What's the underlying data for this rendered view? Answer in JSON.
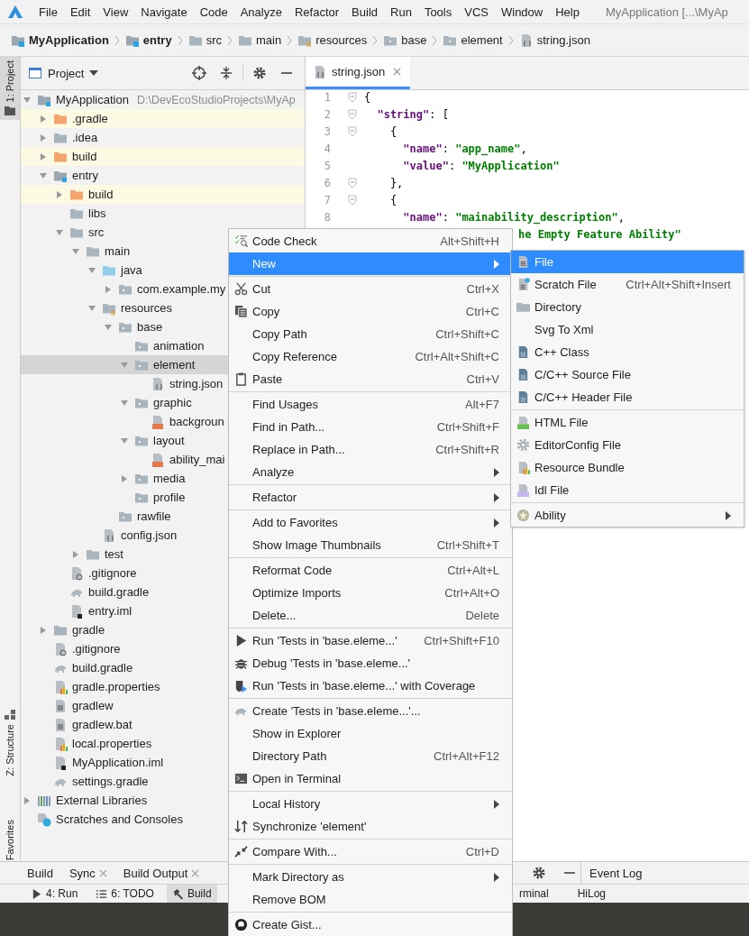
{
  "menubar": {
    "items": [
      "File",
      "Edit",
      "View",
      "Navigate",
      "Code",
      "Analyze",
      "Refactor",
      "Build",
      "Run",
      "Tools",
      "VCS",
      "Window",
      "Help"
    ],
    "title": "MyApplication [...\\MyAp"
  },
  "breadcrumb": [
    {
      "label": "MyApplication",
      "kind": "module"
    },
    {
      "label": "entry",
      "kind": "module"
    },
    {
      "label": "src",
      "kind": "folder"
    },
    {
      "label": "main",
      "kind": "folder"
    },
    {
      "label": "resources",
      "kind": "resources"
    },
    {
      "label": "base",
      "kind": "package"
    },
    {
      "label": "element",
      "kind": "package"
    },
    {
      "label": "string.json",
      "kind": "json"
    }
  ],
  "tool_strip": [
    {
      "label": "1: Project",
      "kind": "project",
      "selected": true
    },
    {
      "label": "Z: Structure",
      "kind": "structure",
      "selected": false
    },
    {
      "label": "Favorites",
      "kind": "favorites",
      "selected": false
    }
  ],
  "project": {
    "title": "Project",
    "tree": [
      {
        "label": "MyApplication",
        "path": "D:\\DevEcoStudioProjects\\MyAp",
        "kind": "module",
        "expanded": true,
        "selected": false,
        "children": [
          {
            "label": ".gradle",
            "kind": "excluded",
            "expanded": false,
            "selected": false
          },
          {
            "label": ".idea",
            "kind": "folder",
            "expanded": false,
            "selected": false
          },
          {
            "label": "build",
            "kind": "excluded",
            "expanded": false,
            "selected": false
          },
          {
            "label": "entry",
            "kind": "module",
            "expanded": true,
            "selected": false,
            "children": [
              {
                "label": "build",
                "kind": "excluded",
                "expanded": false,
                "selected": false
              },
              {
                "label": "libs",
                "kind": "folder",
                "selected": false
              },
              {
                "label": "src",
                "kind": "folder",
                "expanded": true,
                "selected": false,
                "children": [
                  {
                    "label": "main",
                    "kind": "folder",
                    "expanded": true,
                    "selected": false,
                    "children": [
                      {
                        "label": "java",
                        "kind": "source",
                        "expanded": true,
                        "selected": false,
                        "children": [
                          {
                            "label": "com.example.my",
                            "kind": "package",
                            "expanded": false,
                            "selected": false
                          }
                        ]
                      },
                      {
                        "label": "resources",
                        "kind": "resources",
                        "expanded": true,
                        "selected": false,
                        "children": [
                          {
                            "label": "base",
                            "kind": "package",
                            "expanded": true,
                            "selected": false,
                            "children": [
                              {
                                "label": "animation",
                                "kind": "package",
                                "selected": false
                              },
                              {
                                "label": "element",
                                "kind": "package",
                                "expanded": true,
                                "selected": true,
                                "children": [
                                  {
                                    "label": "string.json",
                                    "kind": "json",
                                    "selected": false
                                  }
                                ]
                              },
                              {
                                "label": "graphic",
                                "kind": "package",
                                "expanded": true,
                                "selected": false,
                                "children": [
                                  {
                                    "label": "backgroun",
                                    "kind": "xml",
                                    "selected": false
                                  }
                                ]
                              },
                              {
                                "label": "layout",
                                "kind": "package",
                                "expanded": true,
                                "selected": false,
                                "children": [
                                  {
                                    "label": "ability_mai",
                                    "kind": "xml",
                                    "selected": false
                                  }
                                ]
                              },
                              {
                                "label": "media",
                                "kind": "package",
                                "expanded": false,
                                "selected": false
                              },
                              {
                                "label": "profile",
                                "kind": "package",
                                "selected": false
                              }
                            ]
                          },
                          {
                            "label": "rawfile",
                            "kind": "package",
                            "selected": false
                          }
                        ]
                      },
                      {
                        "label": "config.json",
                        "kind": "json",
                        "selected": false
                      }
                    ]
                  },
                  {
                    "label": "test",
                    "kind": "folder",
                    "expanded": false,
                    "selected": false
                  }
                ]
              },
              {
                "label": ".gitignore",
                "kind": "ignore",
                "selected": false
              },
              {
                "label": "build.gradle",
                "kind": "gradle",
                "selected": false
              },
              {
                "label": "entry.iml",
                "kind": "iml",
                "selected": false
              }
            ]
          },
          {
            "label": "gradle",
            "kind": "folder",
            "expanded": false,
            "selected": false
          },
          {
            "label": ".gitignore",
            "kind": "ignore",
            "selected": false
          },
          {
            "label": "build.gradle",
            "kind": "gradle",
            "selected": false
          },
          {
            "label": "gradle.properties",
            "kind": "properties",
            "selected": false
          },
          {
            "label": "gradlew",
            "kind": "text",
            "selected": false
          },
          {
            "label": "gradlew.bat",
            "kind": "text",
            "selected": false
          },
          {
            "label": "local.properties",
            "kind": "properties",
            "selected": false
          },
          {
            "label": "MyApplication.iml",
            "kind": "iml",
            "selected": false
          },
          {
            "label": "settings.gradle",
            "kind": "gradle",
            "selected": false
          }
        ]
      },
      {
        "label": "External Libraries",
        "kind": "libraries",
        "expanded": false,
        "selected": false
      },
      {
        "label": "Scratches and Consoles",
        "kind": "scratches",
        "selected": false
      }
    ]
  },
  "editor": {
    "tabs": [
      {
        "label": "string.json",
        "selected": true
      }
    ],
    "lines": [
      {
        "number": "1",
        "fold": true,
        "tokens": [
          {
            "text": "{",
            "kind": "punct"
          }
        ]
      },
      {
        "number": "2",
        "fold": true,
        "tokens": [
          {
            "text": "\"string\"",
            "kind": "key"
          },
          {
            "text": ": [",
            "kind": "punct"
          }
        ]
      },
      {
        "number": "3",
        "fold": true,
        "tokens": [
          {
            "text": "{",
            "kind": "punct"
          }
        ]
      },
      {
        "number": "4",
        "fold": false,
        "tokens": [
          {
            "text": "\"name\"",
            "kind": "key"
          },
          {
            "text": ": ",
            "kind": "punct"
          },
          {
            "text": "\"app_name\"",
            "kind": "value"
          },
          {
            "text": ",",
            "kind": "punct"
          }
        ]
      },
      {
        "number": "5",
        "fold": false,
        "tokens": [
          {
            "text": "\"value\"",
            "kind": "key"
          },
          {
            "text": ": ",
            "kind": "punct"
          },
          {
            "text": "\"MyApplication\"",
            "kind": "value"
          }
        ]
      },
      {
        "number": "6",
        "fold": true,
        "tokens": [
          {
            "text": "},",
            "kind": "punct"
          }
        ]
      },
      {
        "number": "7",
        "fold": true,
        "tokens": [
          {
            "text": "{",
            "kind": "punct"
          }
        ]
      },
      {
        "number": "8",
        "fold": false,
        "tokens": [
          {
            "text": "\"name\"",
            "kind": "key"
          },
          {
            "text": ": ",
            "kind": "punct"
          },
          {
            "text": "\"mainability_description\"",
            "kind": "value"
          },
          {
            "text": ",",
            "kind": "punct"
          }
        ]
      }
    ],
    "cut_line": "he Empty Feature Ability\""
  },
  "context_menu": {
    "sections": [
      [
        {
          "label": "Code Check",
          "shortcut": "Alt+Shift+H",
          "kind": "code-check",
          "submenu": false,
          "selected": false
        },
        {
          "label": "New",
          "submenu": true,
          "selected": true
        }
      ],
      [
        {
          "label": "Cut",
          "shortcut": "Ctrl+X",
          "kind": "cut",
          "submenu": false,
          "selected": false
        },
        {
          "label": "Copy",
          "shortcut": "Ctrl+C",
          "kind": "copy",
          "submenu": false,
          "selected": false
        },
        {
          "label": "Copy Path",
          "shortcut": "Ctrl+Shift+C",
          "submenu": false,
          "selected": false
        },
        {
          "label": "Copy Reference",
          "shortcut": "Ctrl+Alt+Shift+C",
          "submenu": false,
          "selected": false
        },
        {
          "label": "Paste",
          "shortcut": "Ctrl+V",
          "kind": "paste",
          "submenu": false,
          "selected": false
        }
      ],
      [
        {
          "label": "Find Usages",
          "shortcut": "Alt+F7",
          "submenu": false,
          "selected": false
        },
        {
          "label": "Find in Path...",
          "shortcut": "Ctrl+Shift+F",
          "submenu": false,
          "selected": false
        },
        {
          "label": "Replace in Path...",
          "shortcut": "Ctrl+Shift+R",
          "submenu": false,
          "selected": false
        },
        {
          "label": "Analyze",
          "submenu": true,
          "selected": false
        }
      ],
      [
        {
          "label": "Refactor",
          "submenu": true,
          "selected": false
        }
      ],
      [
        {
          "label": "Add to Favorites",
          "submenu": true,
          "selected": false
        },
        {
          "label": "Show Image Thumbnails",
          "shortcut": "Ctrl+Shift+T",
          "submenu": false,
          "selected": false
        }
      ],
      [
        {
          "label": "Reformat Code",
          "shortcut": "Ctrl+Alt+L",
          "submenu": false,
          "selected": false
        },
        {
          "label": "Optimize Imports",
          "shortcut": "Ctrl+Alt+O",
          "submenu": false,
          "selected": false
        },
        {
          "label": "Delete...",
          "shortcut": "Delete",
          "submenu": false,
          "selected": false
        }
      ],
      [
        {
          "label": "Run 'Tests in 'base.eleme...'",
          "shortcut": "Ctrl+Shift+F10",
          "kind": "run",
          "submenu": false,
          "selected": false
        },
        {
          "label": "Debug 'Tests in 'base.eleme...'",
          "kind": "debug",
          "submenu": false,
          "selected": false
        },
        {
          "label": "Run 'Tests in 'base.eleme...' with Coverage",
          "kind": "coverage",
          "submenu": false,
          "selected": false
        }
      ],
      [
        {
          "label": "Create 'Tests in 'base.eleme...'...",
          "kind": "gradle",
          "submenu": false,
          "selected": false
        },
        {
          "label": "Show in Explorer",
          "submenu": false,
          "selected": false
        },
        {
          "label": "Directory Path",
          "shortcut": "Ctrl+Alt+F12",
          "submenu": false,
          "selected": false
        },
        {
          "label": "Open in Terminal",
          "kind": "terminal",
          "submenu": false,
          "selected": false
        }
      ],
      [
        {
          "label": "Local History",
          "submenu": true,
          "selected": false
        },
        {
          "label": "Synchronize 'element'",
          "kind": "sync",
          "submenu": false,
          "selected": false
        }
      ],
      [
        {
          "label": "Compare With...",
          "shortcut": "Ctrl+D",
          "kind": "compare",
          "submenu": false,
          "selected": false
        }
      ],
      [
        {
          "label": "Mark Directory as",
          "submenu": true,
          "selected": false
        },
        {
          "label": "Remove BOM",
          "submenu": false,
          "selected": false
        }
      ],
      [
        {
          "label": "Create Gist...",
          "kind": "github",
          "submenu": false,
          "selected": false
        }
      ]
    ]
  },
  "new_submenu": {
    "sections": [
      [
        {
          "label": "File",
          "kind": "file",
          "submenu": false,
          "selected": true
        },
        {
          "label": "Scratch File",
          "shortcut": "Ctrl+Alt+Shift+Insert",
          "kind": "scratch",
          "submenu": false,
          "selected": false
        },
        {
          "label": "Directory",
          "kind": "directory",
          "submenu": false,
          "selected": false
        },
        {
          "label": "Svg To Xml",
          "submenu": false,
          "selected": false
        },
        {
          "label": "C++ Class",
          "kind": "cpp",
          "submenu": false,
          "selected": false
        },
        {
          "label": "C/C++ Source File",
          "kind": "csource",
          "submenu": false,
          "selected": false
        },
        {
          "label": "C/C++ Header File",
          "kind": "cheader",
          "submenu": false,
          "selected": false
        }
      ],
      [
        {
          "label": "HTML File",
          "kind": "html",
          "submenu": false,
          "selected": false
        },
        {
          "label": "EditorConfig File",
          "kind": "editorconfig",
          "submenu": false,
          "selected": false
        },
        {
          "label": "Resource Bundle",
          "kind": "bundle",
          "submenu": false,
          "selected": false
        },
        {
          "label": "Idl File",
          "kind": "idl",
          "submenu": false,
          "selected": false
        }
      ],
      [
        {
          "label": "Ability",
          "kind": "ability",
          "submenu": true,
          "selected": false
        }
      ]
    ]
  },
  "build_window": {
    "title": "Build",
    "tabs": [
      {
        "label": "Sync"
      },
      {
        "label": "Build Output"
      }
    ]
  },
  "event_log": {
    "title": "Event Log"
  },
  "status_bar": {
    "left": [
      {
        "label": "4: Run",
        "kind": "run",
        "selected": false
      },
      {
        "label": "6: TODO",
        "kind": "todo",
        "selected": false
      },
      {
        "label": "Build",
        "kind": "build",
        "selected": true
      }
    ],
    "right": [
      {
        "label": "rminal",
        "selected": false
      },
      {
        "label": "HiLog",
        "selected": false
      }
    ]
  }
}
